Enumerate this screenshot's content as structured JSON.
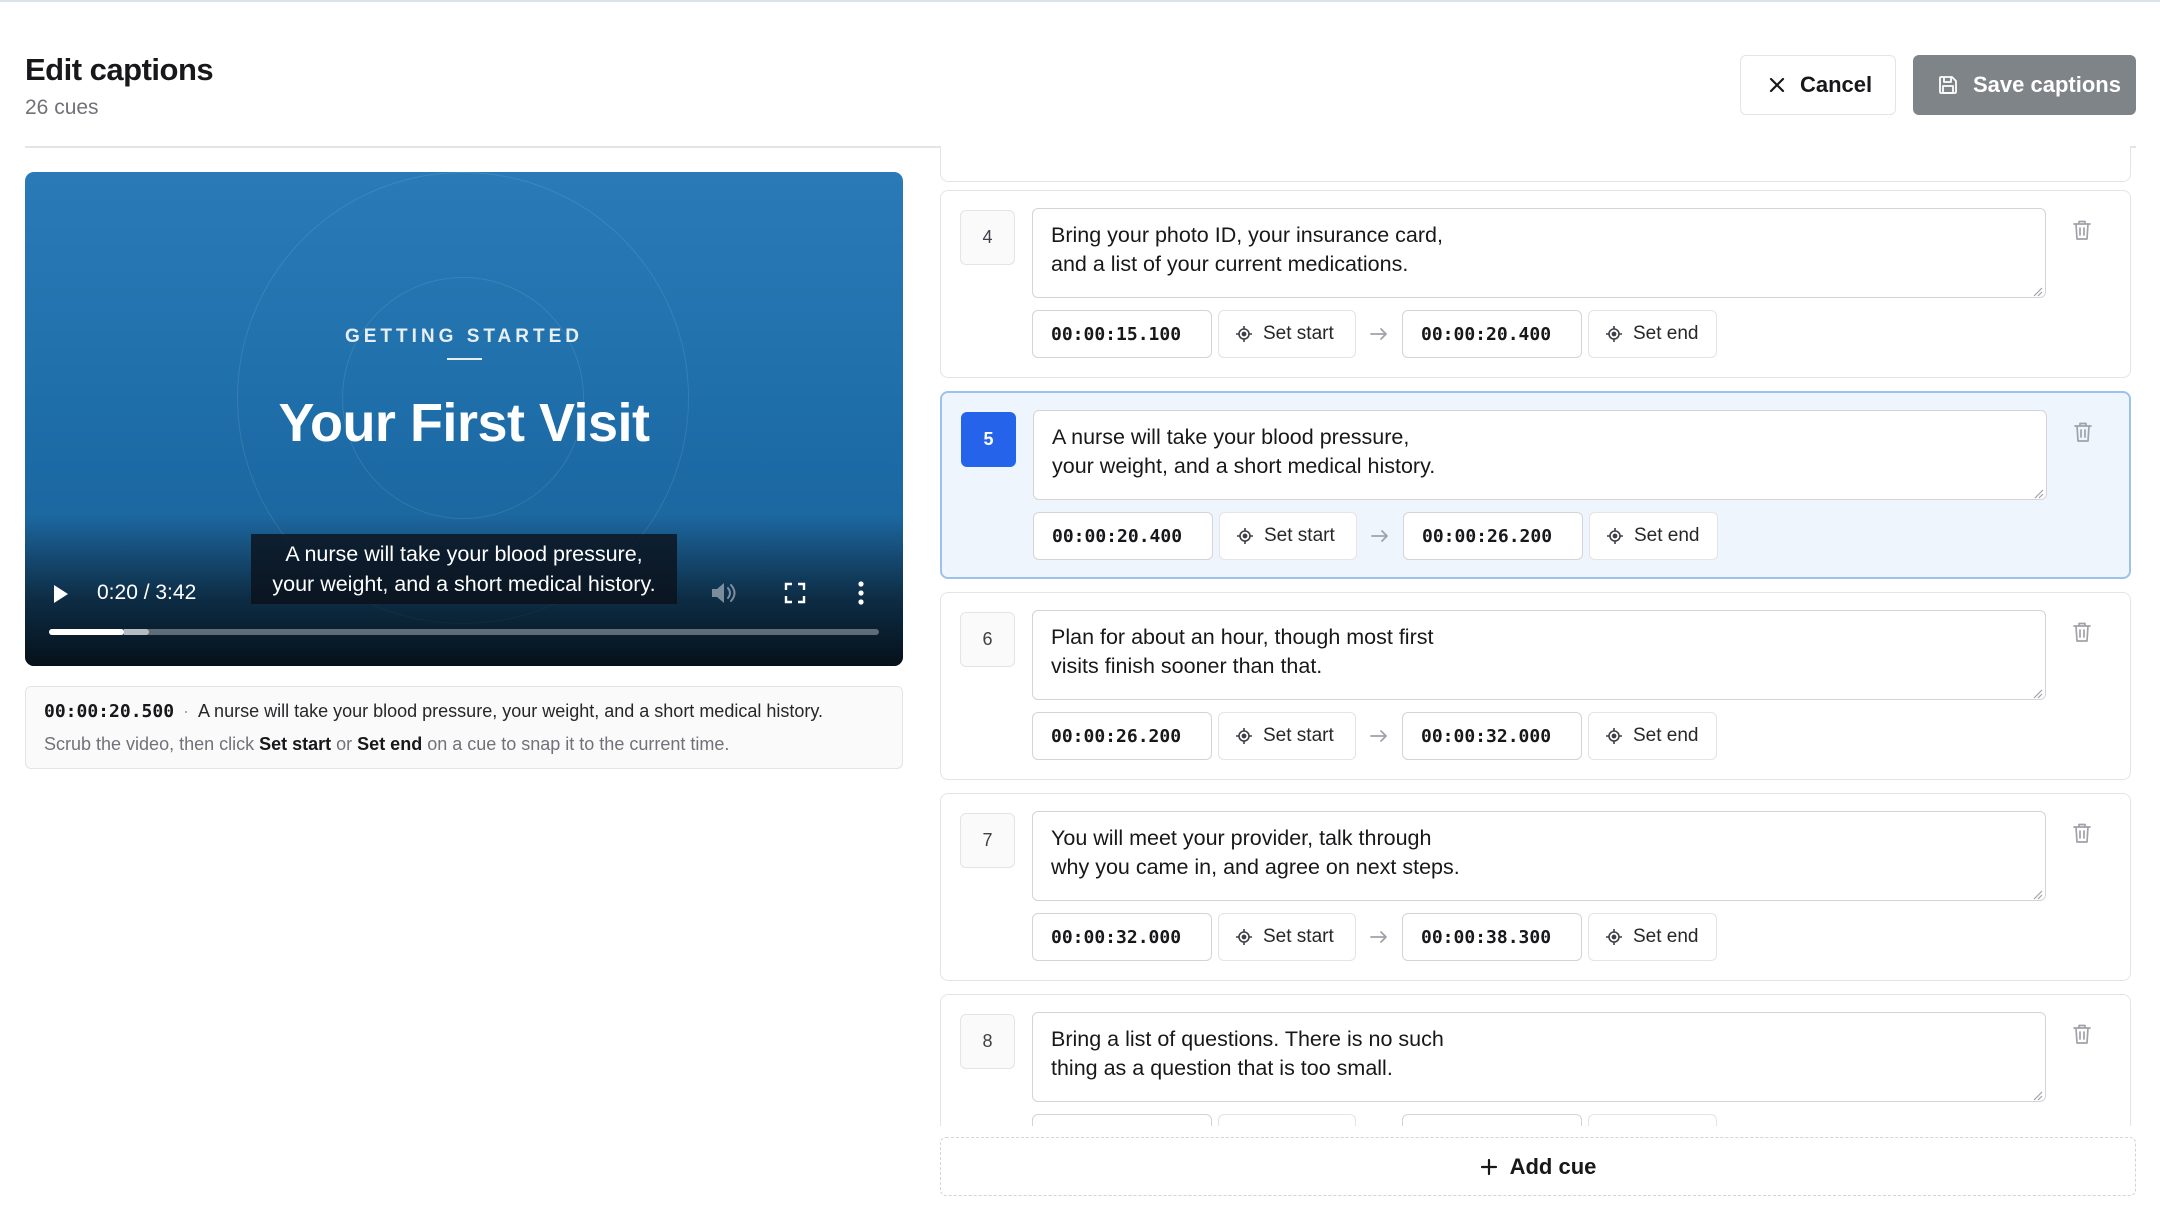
{
  "header": {
    "title": "Edit captions",
    "subtitle": "26 cues",
    "cancel_label": "Cancel",
    "save_label": "Save captions"
  },
  "video": {
    "eyebrow": "GETTING STARTED",
    "title": "Your First Visit",
    "caption_line1": "A nurse will take your blood pressure,",
    "caption_line2": "your weight, and a short medical history.",
    "time": "0:20 / 3:42",
    "progress_fraction": 0.09,
    "buffered_fraction": 0.12
  },
  "info": {
    "current_time": "00:00:20.500",
    "separator": "·",
    "current_caption": "A nurse will take your blood pressure, your weight, and a short medical history.",
    "hint_before": "Scrub the video, then click ",
    "hint_set_start": "Set start",
    "hint_or": " or ",
    "hint_set_end": "Set end",
    "hint_after": " on a cue to snap it to the current time."
  },
  "cue_buttons": {
    "set_start": "Set start",
    "set_end": "Set end"
  },
  "cues": [
    {
      "number": "4",
      "text": "Bring your photo ID, your insurance card,\nand a list of your current medications.",
      "start": "00:00:15.100",
      "end": "00:00:20.400",
      "active": false
    },
    {
      "number": "5",
      "text": "A nurse will take your blood pressure,\nyour weight, and a short medical history.",
      "start": "00:00:20.400",
      "end": "00:00:26.200",
      "active": true
    },
    {
      "number": "6",
      "text": "Plan for about an hour, though most first\nvisits finish sooner than that.",
      "start": "00:00:26.200",
      "end": "00:00:32.000",
      "active": false
    },
    {
      "number": "7",
      "text": "You will meet your provider, talk through\nwhy you came in, and agree on next steps.",
      "start": "00:00:32.000",
      "end": "00:00:38.300",
      "active": false
    },
    {
      "number": "8",
      "text": "Bring a list of questions. There is no such\nthing as a question that is too small.",
      "start": "",
      "end": "",
      "active": false
    }
  ],
  "add_cue_label": "Add cue",
  "colors": {
    "accent": "#2563eb",
    "active_cue_bg": "#eef5fd",
    "save_button_disabled": "#7f8489"
  }
}
